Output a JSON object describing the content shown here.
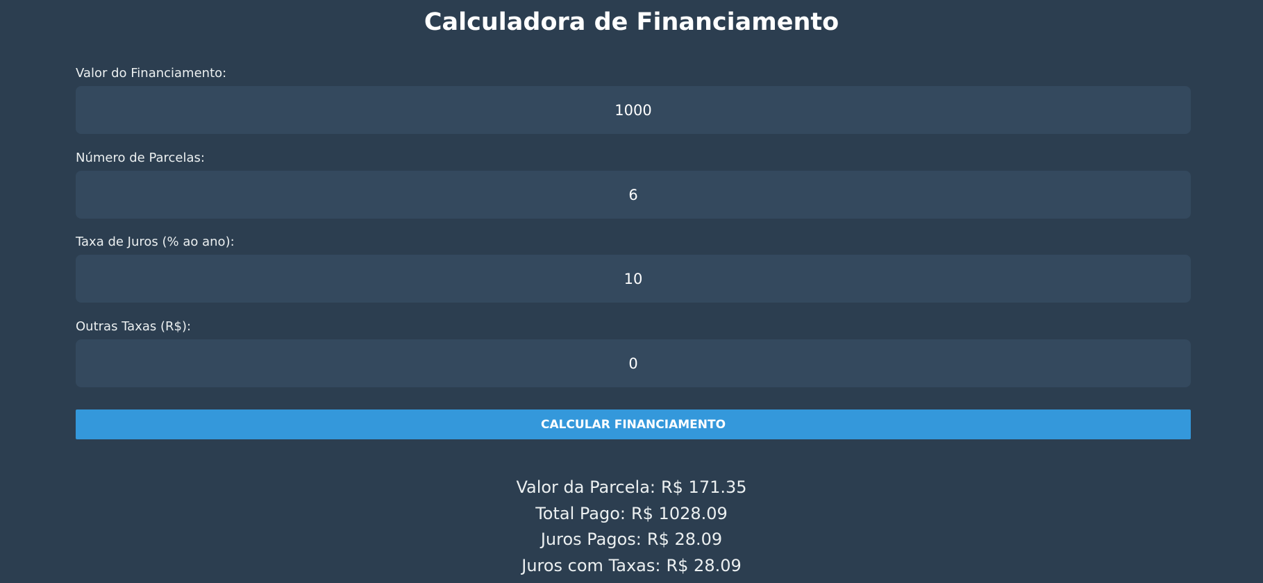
{
  "page": {
    "title": "Calculadora de Financiamento"
  },
  "form": {
    "fields": [
      {
        "label": "Valor do Financiamento:",
        "value": "1000"
      },
      {
        "label": "Número de Parcelas:",
        "value": "6"
      },
      {
        "label": "Taxa de Juros (% ao ano):",
        "value": "10"
      },
      {
        "label": "Outras Taxas (R$):",
        "value": "0"
      }
    ],
    "submit_label": "Calcular Financiamento"
  },
  "results": [
    {
      "label": "Valor da Parcela:",
      "value": "R$ 171.35"
    },
    {
      "label": "Total Pago:",
      "value": "R$ 1028.09"
    },
    {
      "label": "Juros Pagos:",
      "value": "R$ 28.09"
    },
    {
      "label": "Juros com Taxas:",
      "value": "R$ 28.09"
    }
  ],
  "colors": {
    "background": "#2c3e50",
    "input_background": "#34495e",
    "accent": "#3498db",
    "text": "#ffffff"
  }
}
